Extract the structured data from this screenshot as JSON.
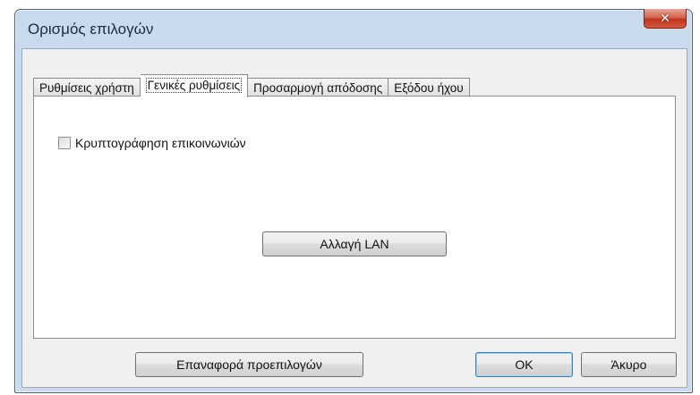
{
  "window": {
    "title": "Ορισμός επιλογών",
    "close_symbol": "✕"
  },
  "tabs": [
    {
      "label": "Ρυθμίσεις χρήστη",
      "active": false
    },
    {
      "label": "Γενικές ρυθμίσεις",
      "active": true
    },
    {
      "label": "Προσαρμογή απόδοσης",
      "active": false
    },
    {
      "label": "Εξόδου ήχου",
      "active": false
    }
  ],
  "general": {
    "encrypt_checkbox_label": "Κρυπτογράφηση επικοινωνιών",
    "encrypt_checked": false,
    "lan_button_label": "Αλλαγή LAN"
  },
  "footer": {
    "reset_label": "Επαναφορά προεπιλογών",
    "ok_label": "OK",
    "cancel_label": "Άκυρο"
  },
  "colors": {
    "frame": "#c9daee",
    "close_button": "#c2331e",
    "default_button_border": "#3c7fb1"
  }
}
